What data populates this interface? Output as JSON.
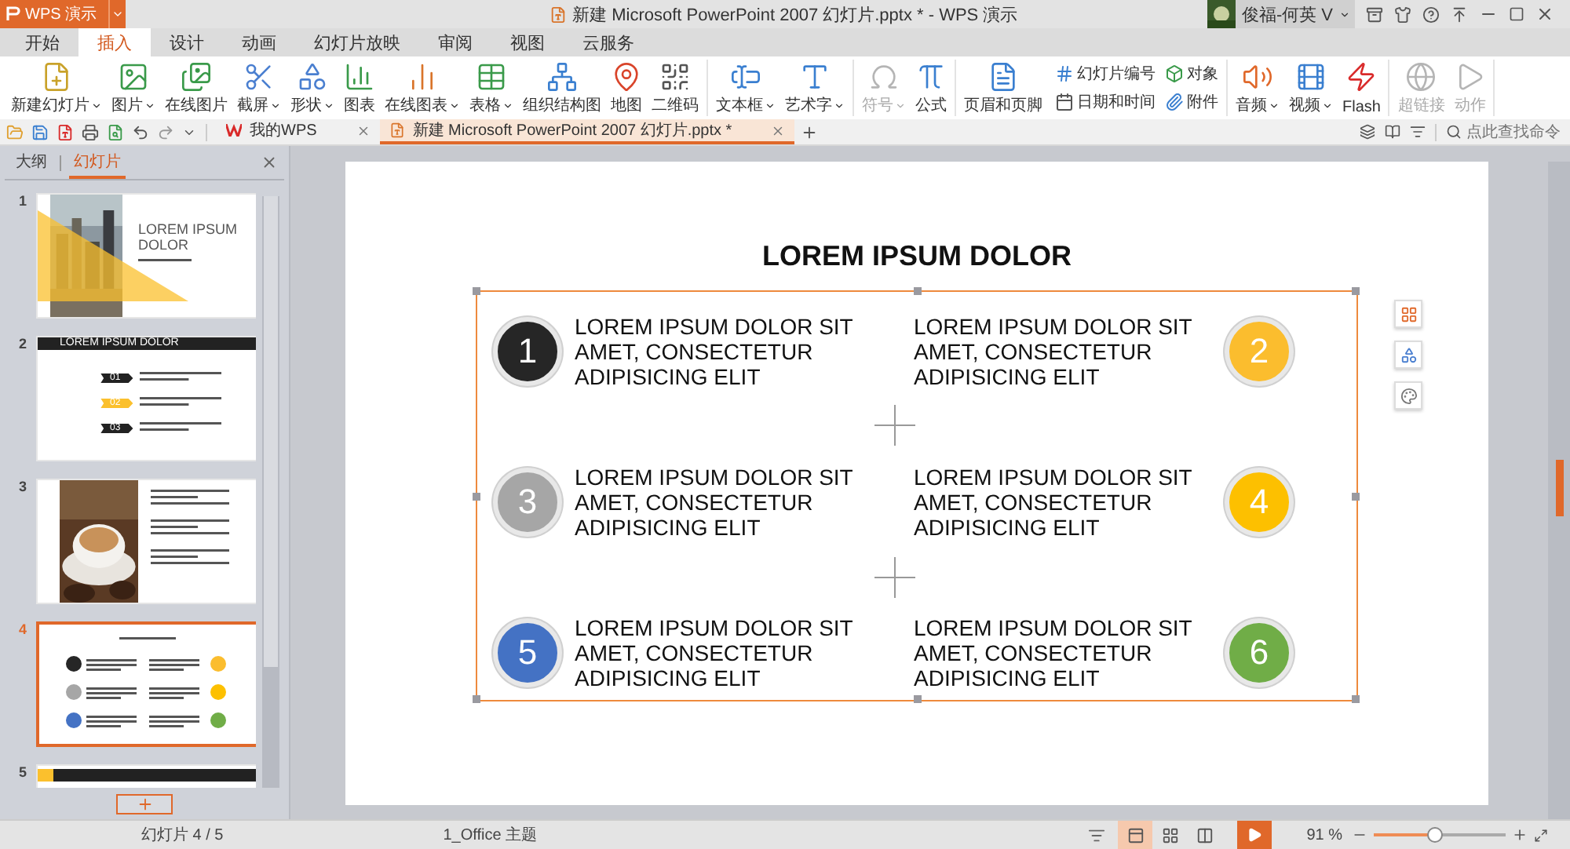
{
  "app_button": {
    "label": "WPS 演示"
  },
  "window": {
    "title": "新建 Microsoft PowerPoint 2007 幻灯片.pptx * - WPS 演示",
    "user": "俊福-何英 V"
  },
  "menu_tabs": [
    {
      "label": "开始",
      "selected": false
    },
    {
      "label": "插入",
      "selected": true
    },
    {
      "label": "设计",
      "selected": false
    },
    {
      "label": "动画",
      "selected": false
    },
    {
      "label": "幻灯片放映",
      "selected": false
    },
    {
      "label": "审阅",
      "selected": false
    },
    {
      "label": "视图",
      "selected": false
    },
    {
      "label": "云服务",
      "selected": false
    }
  ],
  "ribbon_groups": [
    {
      "items": [
        {
          "label": "新建幻灯片",
          "kind": "large",
          "menu": true,
          "disabled": false
        },
        {
          "label": "图片",
          "kind": "large",
          "menu": true,
          "disabled": false
        },
        {
          "label": "在线图片",
          "kind": "large",
          "menu": false,
          "disabled": false
        },
        {
          "label": "截屏",
          "kind": "large",
          "menu": true,
          "disabled": false
        },
        {
          "label": "形状",
          "kind": "large",
          "menu": true,
          "disabled": false
        },
        {
          "label": "图表",
          "kind": "large",
          "menu": false,
          "disabled": false
        },
        {
          "label": "在线图表",
          "kind": "large",
          "menu": true,
          "disabled": false
        },
        {
          "label": "表格",
          "kind": "large",
          "menu": true,
          "disabled": false
        },
        {
          "label": "组织结构图",
          "kind": "large",
          "menu": false,
          "disabled": false
        },
        {
          "label": "地图",
          "kind": "large",
          "menu": false,
          "disabled": false
        },
        {
          "label": "二维码",
          "kind": "large",
          "menu": false,
          "disabled": false
        }
      ]
    },
    {
      "items": [
        {
          "label": "文本框",
          "kind": "large",
          "menu": true,
          "disabled": false
        },
        {
          "label": "艺术字",
          "kind": "large",
          "menu": true,
          "disabled": false
        }
      ]
    },
    {
      "items": [
        {
          "label": "符号",
          "kind": "large",
          "menu": true,
          "disabled": true
        },
        {
          "label": "公式",
          "kind": "large",
          "menu": false,
          "disabled": false
        }
      ]
    },
    {
      "items": [
        {
          "label": "页眉和页脚",
          "kind": "large",
          "menu": false,
          "disabled": false
        },
        {
          "label": "幻灯片编号",
          "kind": "small",
          "menu": false,
          "disabled": false
        },
        {
          "label": "日期和时间",
          "kind": "small",
          "menu": false,
          "disabled": false
        },
        {
          "label": "对象",
          "kind": "small",
          "menu": false,
          "disabled": false
        },
        {
          "label": "附件",
          "kind": "small",
          "menu": false,
          "disabled": false
        }
      ]
    },
    {
      "items": [
        {
          "label": "音频",
          "kind": "large",
          "menu": true,
          "disabled": false
        },
        {
          "label": "视频",
          "kind": "large",
          "menu": true,
          "disabled": false
        },
        {
          "label": "Flash",
          "kind": "large",
          "menu": false,
          "disabled": false
        }
      ]
    },
    {
      "items": [
        {
          "label": "超链接",
          "kind": "large",
          "menu": false,
          "disabled": true
        },
        {
          "label": "动作",
          "kind": "large",
          "menu": false,
          "disabled": true
        }
      ]
    }
  ],
  "doc_tabs": [
    {
      "label": "我的WPS",
      "selected": false
    },
    {
      "label": "新建 Microsoft PowerPoint 2007 幻灯片.pptx *",
      "selected": true
    }
  ],
  "command_search": {
    "placeholder": "点此查找命令"
  },
  "panel": {
    "tabs": [
      {
        "label": "大纲",
        "selected": false
      },
      {
        "label": "幻灯片",
        "selected": true
      }
    ],
    "thumbnails": [
      {
        "number": "1",
        "kind": "cover",
        "selected": false,
        "title": "LOREM IPSUM DOLOR"
      },
      {
        "number": "2",
        "kind": "agenda",
        "selected": false,
        "title": "LOREM IPSUM DOLOR",
        "labels": [
          "01",
          "02",
          "03"
        ]
      },
      {
        "number": "3",
        "selected": false
      },
      {
        "number": "4",
        "kind": "grid",
        "selected": true
      },
      {
        "number": "5",
        "kind": "banner",
        "selected": false
      }
    ]
  },
  "slide": {
    "title": "LOREM IPSUM DOLOR",
    "items": [
      {
        "number": "1",
        "text": "LOREM IPSUM DOLOR SIT AMET, CONSECTETUR ADIPISICING ELIT",
        "color": "#262626"
      },
      {
        "number": "2",
        "text": "LOREM IPSUM DOLOR SIT AMET, CONSECTETUR ADIPISICING ELIT",
        "color": "#fbbd2e"
      },
      {
        "number": "3",
        "text": "LOREM IPSUM DOLOR SIT AMET, CONSECTETUR ADIPISICING ELIT",
        "color": "#a6a6a6"
      },
      {
        "number": "4",
        "text": "LOREM IPSUM DOLOR SIT AMET, CONSECTETUR ADIPISICING ELIT",
        "color": "#fdc000"
      },
      {
        "number": "5",
        "text": "LOREM IPSUM DOLOR SIT AMET, CONSECTETUR ADIPISICING ELIT",
        "color": "#4472c4"
      },
      {
        "number": "6",
        "text": "LOREM IPSUM DOLOR SIT AMET, CONSECTETUR ADIPISICING ELIT",
        "color": "#70ad47"
      }
    ]
  },
  "status_bar": {
    "slide_counter": "幻灯片 4 / 5",
    "theme": "1_Office 主题",
    "zoom": "91 %",
    "zoom_slider": {
      "level": 0.45
    }
  }
}
